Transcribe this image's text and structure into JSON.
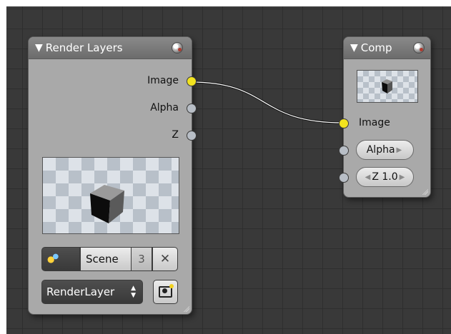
{
  "render_layers_node": {
    "title": "Render Layers",
    "outputs": [
      "Image",
      "Alpha",
      "Z"
    ],
    "scene": {
      "name": "Scene",
      "user_count": "3"
    },
    "layer_select": {
      "value": "RenderLayer"
    },
    "icons": {
      "collapse": "triangle-down",
      "preview": "sphere",
      "scene": "scene-data",
      "unlink": "x",
      "render": "camera"
    }
  },
  "composite_node": {
    "title": "Comp",
    "inputs": {
      "image": "Image",
      "alpha": "Alpha",
      "z": "Z 1.0"
    }
  },
  "colors": {
    "grid_bg": "#393939",
    "node_body": "#a9a9a9",
    "socket_color": "#f2e31f",
    "socket_value": "#b8bec6"
  }
}
